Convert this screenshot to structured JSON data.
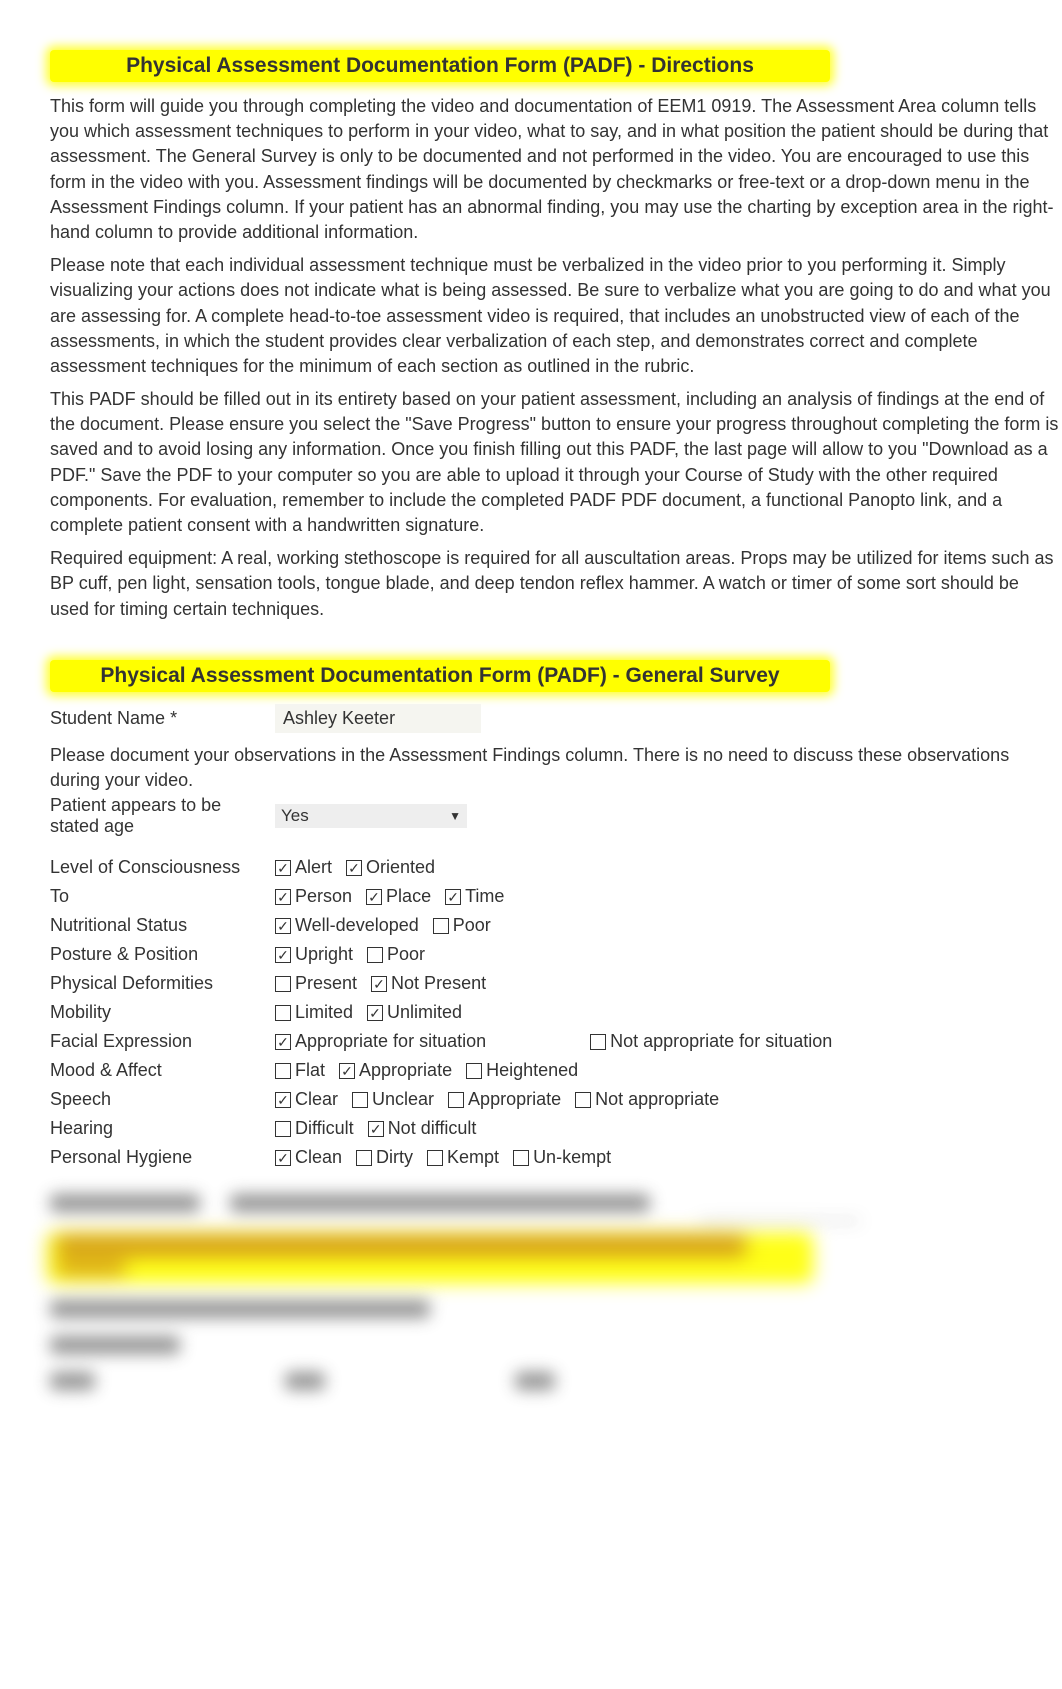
{
  "titles": {
    "directions": "Physical Assessment Documentation Form (PADF) - Directions",
    "general_survey": "Physical Assessment Documentation Form (PADF) - General Survey"
  },
  "directions_paragraphs": {
    "p1": "This form will guide you through completing the video and documentation of EEM1 0919. The Assessment Area column tells you which assessment techniques to perform in your video, what to say, and in what position the patient should be during that assessment. The General Survey is only to be documented and not performed in the video. You are encouraged to use this form in the video with you. Assessment findings will be documented by checkmarks or free-text or a drop-down menu in the Assessment Findings column. If your patient has an abnormal finding, you may use the charting by exception area in the right-hand column to provide additional information.",
    "p2": "Please note that each individual assessment technique must be verbalized in the video prior to you performing it. Simply visualizing your actions does not indicate what is being assessed. Be sure to verbalize what you are going to do and what you are assessing for. A complete head-to-toe assessment video is required, that includes an unobstructed view of each of the assessments, in which the student provides clear verbalization of each step, and demonstrates correct and complete assessment techniques for the minimum of each section as outlined in the rubric.",
    "p3": "This PADF should be filled out in its entirety based on your patient assessment, including an analysis of findings at the end of the document. Please ensure you select the \"Save Progress\" button to ensure your progress throughout completing the form is saved and to avoid losing any information. Once you finish filling out this PADF, the last page will allow to you \"Download as a PDF.\" Save the PDF to your computer so you are able to upload it through your Course of Study with the other required components. For evaluation, remember to include the completed PADF PDF document, a functional Panopto link, and a complete patient consent with a handwritten signature.",
    "p4": "Required equipment: A real, working stethoscope is required for all auscultation areas. Props may be utilized for items such as BP cuff, pen light, sensation tools, tongue blade, and deep tendon reflex hammer. A watch or timer of some sort should be used for timing certain techniques."
  },
  "student_name": {
    "label": "Student Name *",
    "value": "Ashley Keeter"
  },
  "observation_instructions": "Please document your observations in the Assessment Findings column. There is no need to discuss these observations during your video.",
  "stated_age": {
    "label": "Patient appears to be stated age",
    "value": "Yes"
  },
  "fields": {
    "loc": {
      "label": "Level of Consciousness",
      "options": [
        {
          "label": "Alert",
          "checked": true
        },
        {
          "label": "Oriented",
          "checked": true
        }
      ]
    },
    "to": {
      "label": "To",
      "options": [
        {
          "label": "Person",
          "checked": true
        },
        {
          "label": "Place",
          "checked": true
        },
        {
          "label": "Time",
          "checked": true
        }
      ]
    },
    "nutritional": {
      "label": "Nutritional Status",
      "options": [
        {
          "label": "Well-developed",
          "checked": true
        },
        {
          "label": "Poor",
          "checked": false
        }
      ]
    },
    "posture": {
      "label": "Posture & Position",
      "options": [
        {
          "label": "Upright",
          "checked": true
        },
        {
          "label": "Poor",
          "checked": false
        }
      ]
    },
    "deformities": {
      "label": "Physical Deformities",
      "options": [
        {
          "label": "Present",
          "checked": false
        },
        {
          "label": "Not Present",
          "checked": true
        }
      ]
    },
    "mobility": {
      "label": "Mobility",
      "options": [
        {
          "label": "Limited",
          "checked": false
        },
        {
          "label": "Unlimited",
          "checked": true
        }
      ]
    },
    "facial": {
      "label": "Facial Expression",
      "options": [
        {
          "label": "Appropriate for situation",
          "checked": true
        },
        {
          "label": "Not appropriate for situation",
          "checked": false
        }
      ]
    },
    "mood": {
      "label": "Mood & Affect",
      "options": [
        {
          "label": "Flat",
          "checked": false
        },
        {
          "label": "Appropriate",
          "checked": true
        },
        {
          "label": "Heightened",
          "checked": false
        }
      ]
    },
    "speech": {
      "label": "Speech",
      "options": [
        {
          "label": "Clear",
          "checked": true
        },
        {
          "label": "Unclear",
          "checked": false
        },
        {
          "label": "Appropriate",
          "checked": false
        },
        {
          "label": "Not appropriate",
          "checked": false
        }
      ]
    },
    "hearing": {
      "label": "Hearing",
      "options": [
        {
          "label": "Difficult",
          "checked": false
        },
        {
          "label": "Not difficult",
          "checked": true
        }
      ]
    },
    "hygiene": {
      "label": "Personal Hygiene",
      "options": [
        {
          "label": "Clean",
          "checked": true
        },
        {
          "label": "Dirty",
          "checked": false
        },
        {
          "label": "Kempt",
          "checked": false
        },
        {
          "label": "Un-kempt",
          "checked": false
        }
      ]
    }
  }
}
